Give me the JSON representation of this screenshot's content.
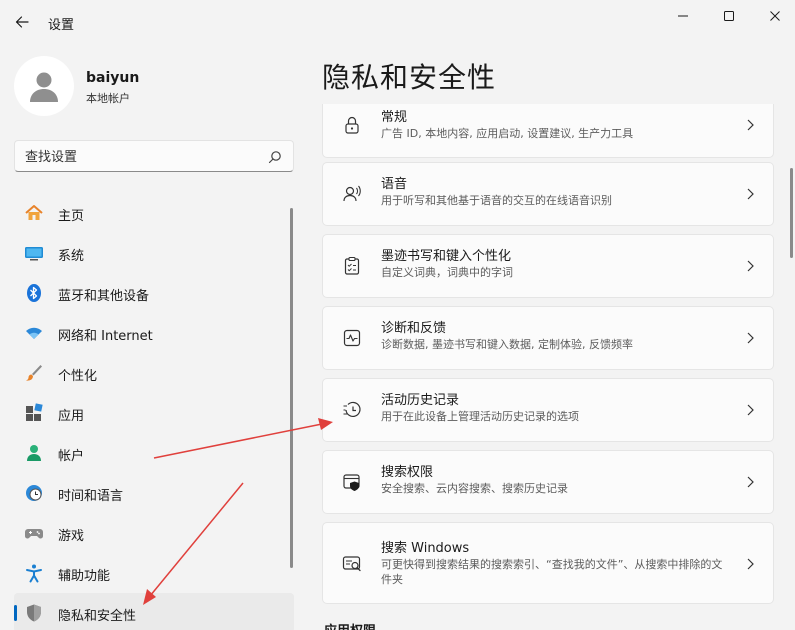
{
  "window": {
    "title": "设置",
    "back_icon": "arrow-left-icon",
    "controls": [
      "minimize-icon",
      "maximize-icon",
      "close-icon"
    ]
  },
  "profile": {
    "name": "baiyun",
    "account_type": "本地帐户"
  },
  "search": {
    "placeholder": "查找设置"
  },
  "sidebar": {
    "items": [
      {
        "label": "主页",
        "icon": "home-icon"
      },
      {
        "label": "系统",
        "icon": "monitor-icon"
      },
      {
        "label": "蓝牙和其他设备",
        "icon": "bluetooth-icon"
      },
      {
        "label": "网络和 Internet",
        "icon": "wifi-icon"
      },
      {
        "label": "个性化",
        "icon": "brush-icon"
      },
      {
        "label": "应用",
        "icon": "apps-icon"
      },
      {
        "label": "帐户",
        "icon": "person-icon"
      },
      {
        "label": "时间和语言",
        "icon": "clock-globe-icon"
      },
      {
        "label": "游戏",
        "icon": "gamepad-icon"
      },
      {
        "label": "辅助功能",
        "icon": "accessibility-icon"
      },
      {
        "label": "隐私和安全性",
        "icon": "shield-icon",
        "selected": true
      }
    ]
  },
  "main": {
    "title": "隐私和安全性",
    "cards": [
      {
        "title": "常规",
        "desc": "广告 ID, 本地内容, 应用启动, 设置建议, 生产力工具",
        "icon": "lock-icon"
      },
      {
        "title": "语音",
        "desc": "用于听写和其他基于语音的交互的在线语音识别",
        "icon": "speech-icon"
      },
      {
        "title": "墨迹书写和键入个性化",
        "desc": "自定义词典，词典中的字词",
        "icon": "clipboard-check-icon"
      },
      {
        "title": "诊断和反馈",
        "desc": "诊断数据, 墨迹书写和键入数据, 定制体验, 反馈频率",
        "icon": "diagnostics-icon"
      },
      {
        "title": "活动历史记录",
        "desc": "用于在此设备上管理活动历史记录的选项",
        "icon": "history-icon"
      },
      {
        "title": "搜索权限",
        "desc": "安全搜索、云内容搜索、搜索历史记录",
        "icon": "search-shield-icon"
      },
      {
        "title": "搜索 Windows",
        "desc": "可更快得到搜索结果的搜索索引、“查找我的文件”、从搜索中排除的文件夹",
        "icon": "search-windows-icon"
      }
    ],
    "section_heading": "应用权限"
  },
  "colors": {
    "accent": "#0067c0",
    "annotation": "#e0403c",
    "background": "#f3f3f3",
    "card": "#fbfbfb"
  }
}
